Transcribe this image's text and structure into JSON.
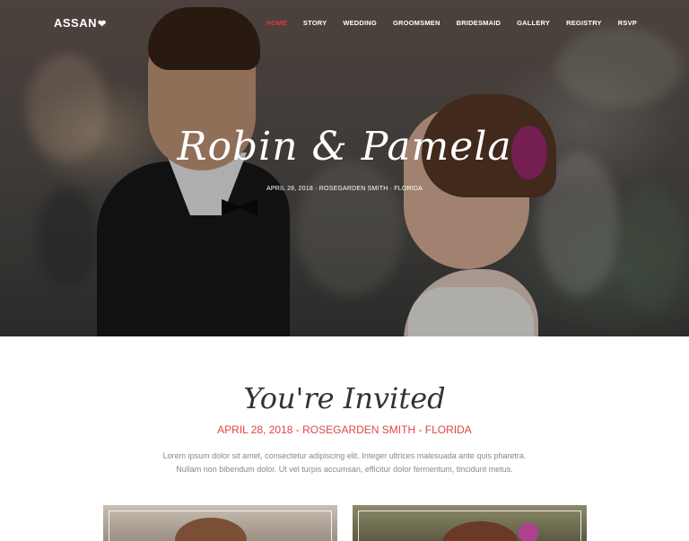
{
  "brand": {
    "name": "ASSAN",
    "icon": "heart-icon"
  },
  "nav": {
    "items": [
      {
        "label": "HOME",
        "active": true
      },
      {
        "label": "STORY"
      },
      {
        "label": "WEDDING"
      },
      {
        "label": "GROOMSMEN"
      },
      {
        "label": "BRIDESMAID"
      },
      {
        "label": "GALLERY"
      },
      {
        "label": "REGISTRY"
      },
      {
        "label": "RSVP"
      }
    ]
  },
  "hero": {
    "title": "Robin & Pamela",
    "subtitle": "APRIL 28, 2018 · ROSEGARDEN SMITH · FLORIDA"
  },
  "invite": {
    "title": "You're Invited",
    "date_line": "APRIL 28, 2018 - ROSEGARDEN SMITH - FLORIDA",
    "body": "Lorem ipsum dolor sit amet, consectetur adipiscing elit. Integer ultrices malesuada ante quis pharetra. Nullam non bibendum dolor. Ut vel turpis accumsan, efficitur dolor fermentum, tincidunt metus."
  },
  "colors": {
    "accent": "#e23838",
    "date_accent": "#e04545"
  }
}
